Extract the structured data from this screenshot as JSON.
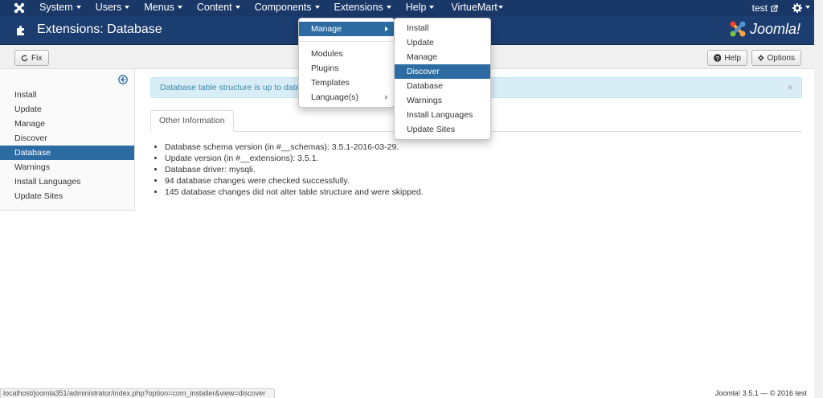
{
  "navbar": {
    "brand_icon": "joomla-icon",
    "items": [
      "System",
      "Users",
      "Menus",
      "Content",
      "Components",
      "Extensions",
      "Help",
      "VirtueMart"
    ],
    "user": "test"
  },
  "header": {
    "title": "Extensions: Database",
    "logo_text": "Joomla!"
  },
  "toolbar": {
    "fix_label": "Fix",
    "help_label": "Help",
    "options_label": "Options"
  },
  "sidebar": {
    "items": [
      "Install",
      "Update",
      "Manage",
      "Discover",
      "Database",
      "Warnings",
      "Install Languages",
      "Update Sites"
    ],
    "active": "Database"
  },
  "alert": {
    "message": "Database table structure is up to date.",
    "close": "×"
  },
  "tabs": {
    "active": "Other Information"
  },
  "info": [
    "Database schema version (in #__schemas): 3.5.1-2016-03-29.",
    "Update version (in #__extensions): 3.5.1.",
    "Database driver: mysqli.",
    "94 database changes were checked successfully.",
    "145 database changes did not alter table structure and were skipped."
  ],
  "extensions_menu": {
    "manage": "Manage",
    "modules": "Modules",
    "plugins": "Plugins",
    "templates": "Templates",
    "languages": "Language(s)"
  },
  "manage_submenu": {
    "items": [
      "Install",
      "Update",
      "Manage",
      "Discover",
      "Database",
      "Warnings",
      "Install Languages",
      "Update Sites"
    ],
    "highlighted": "Discover"
  },
  "statusbar": {
    "url": "localhost/joomla351/administrator/index.php?option=com_installer&view=discover"
  },
  "footer": {
    "text": "Joomla! 3.5.1  —  © 2016 test"
  },
  "colors": {
    "navbar": "#1a3867",
    "header": "#1c3d70",
    "active": "#2d6ca2",
    "alert_bg": "#d9edf7",
    "alert_text": "#3a87ad"
  }
}
